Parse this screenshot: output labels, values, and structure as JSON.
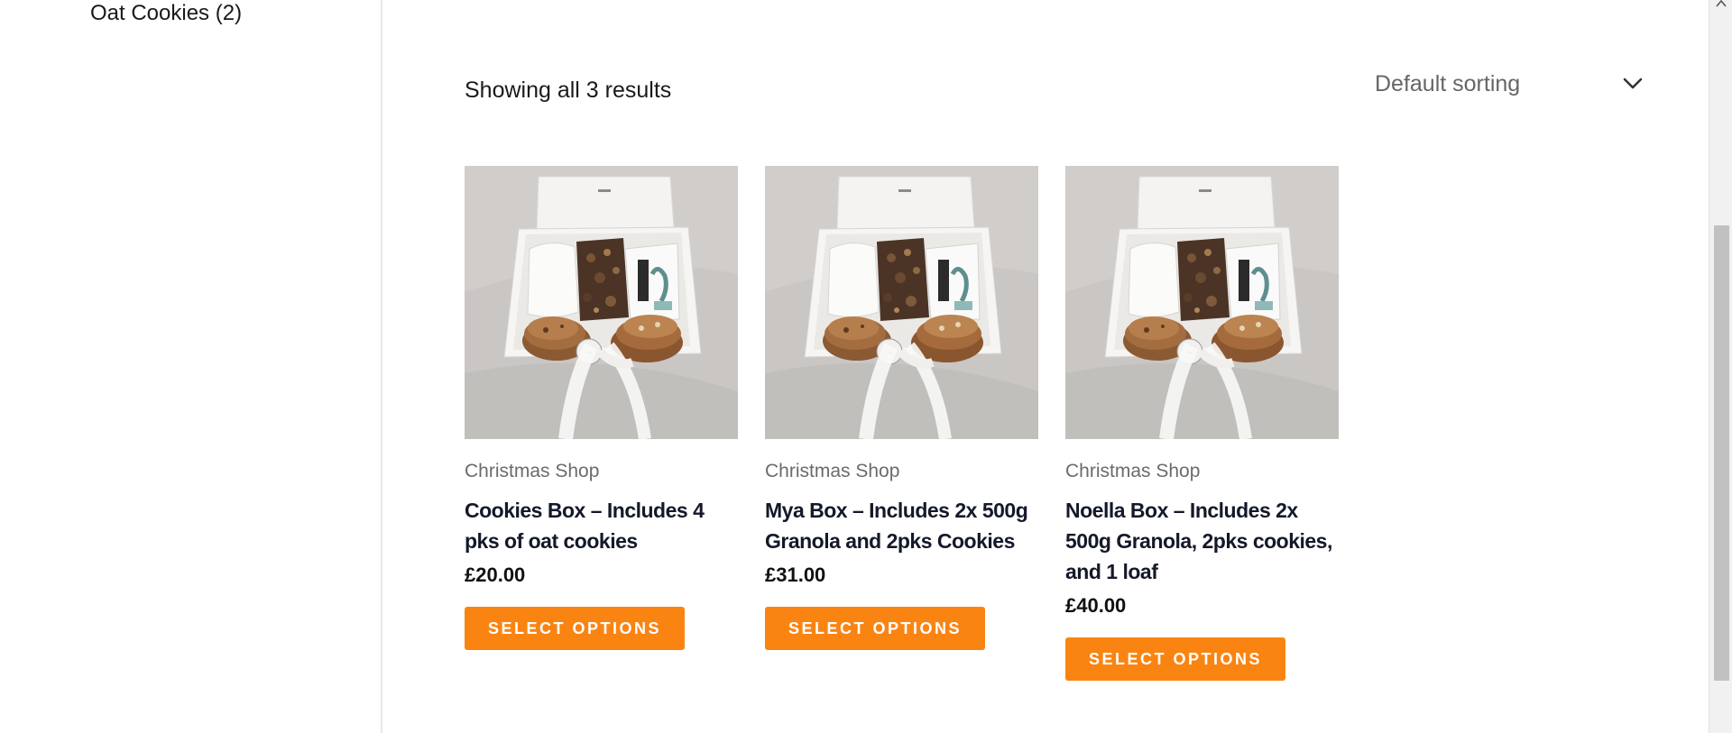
{
  "sidebar": {
    "category_link": "Oat Cookies (2)"
  },
  "toolbar": {
    "result_count": "Showing all 3 results",
    "sort_selected": "Default sorting"
  },
  "products": [
    {
      "category": "Christmas Shop",
      "title": "Cookies Box – Includes 4 pks of oat cookies",
      "price": "£20.00",
      "button_label": "SELECT OPTIONS"
    },
    {
      "category": "Christmas Shop",
      "title": "Mya Box – Includes 2x 500g Granola and 2pks Cookies",
      "price": "£31.00",
      "button_label": "SELECT OPTIONS"
    },
    {
      "category": "Christmas Shop",
      "title": "Noella Box – Includes 2x 500g Granola, 2pks cookies, and 1 loaf",
      "price": "£40.00",
      "button_label": "SELECT OPTIONS"
    }
  ],
  "colors": {
    "accent": "#fa8412",
    "title_text": "#14182a",
    "muted_text": "#6b6b6b"
  },
  "icons": {
    "sort": "chevron-down-icon",
    "scroll": "scroll-up-arrow-icon"
  }
}
